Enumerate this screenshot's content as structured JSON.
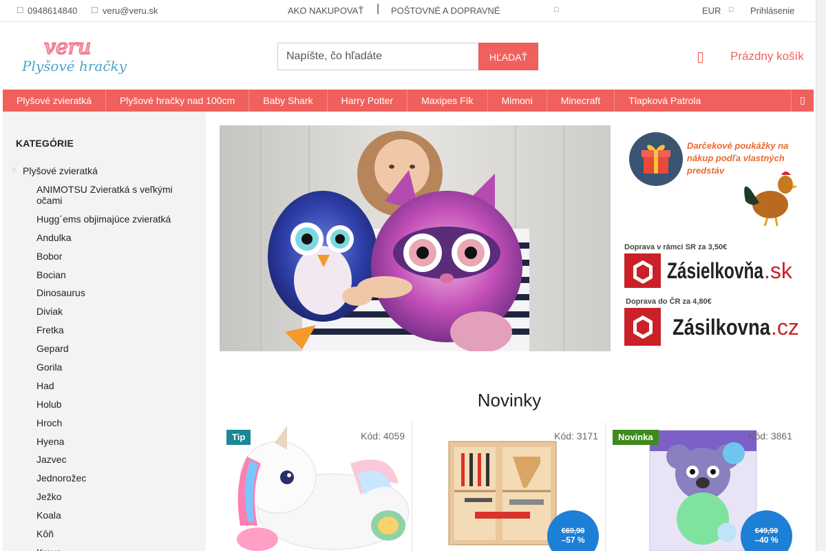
{
  "topbar": {
    "phone_icon": "phone-icon",
    "phone": "0948614840",
    "email_icon": "envelope-icon",
    "email": "veru@veru.sk",
    "link_shopping": "AKO NAKUPOVAŤ",
    "separator": "|",
    "link_shipping": "POŠTOVNÉ A DOPRAVNÉ",
    "more_icon": "chevron-down-icon",
    "currency": "EUR",
    "currency_icon": "chevron-down-icon",
    "login": "Prihlásenie"
  },
  "header": {
    "logo_word": "veru",
    "logo_sub": "Plyšové hračky",
    "search_placeholder": "Napíšte, čo hľadáte",
    "search_button": "HĽADAŤ",
    "cart_icon": "cart-icon",
    "cart_label": "Prázdny košík"
  },
  "nav": {
    "items": [
      "Plyšové zvieratká",
      "Plyšové hračky nad 100cm",
      "Baby Shark",
      "Harry Potter",
      "Maxipes Fík",
      "Mimoni",
      "Minecraft",
      "Tlapková Patrola"
    ],
    "more_icon": "menu-more-icon"
  },
  "sidebar": {
    "title": "KATEGÓRIE",
    "root": "Plyšové zvieratká",
    "items": [
      "ANIMOTSU Zvieratká s veľkými očami",
      "Hugg´ems objimajúce zvieratká",
      "Andulka",
      "Bobor",
      "Bocian",
      "Dinosaurus",
      "Diviak",
      "Fretka",
      "Gepard",
      "Gorila",
      "Had",
      "Holub",
      "Hroch",
      "Hyena",
      "Jazvec",
      "Jednorožec",
      "Ježko",
      "Koala",
      "Kôň",
      "Krava"
    ]
  },
  "promo": {
    "gift_text_1": "Darčekové poukážky na",
    "gift_text_2": "nákup podľa vlastných",
    "gift_text_3": "predstáv",
    "sk_note": "Doprava v rámci SR za 3,50€",
    "sk_brand": "Zásielkovňa",
    "sk_tld": ".sk",
    "cz_note": "Doprava do ČR za 4,80€",
    "cz_brand": "Zásilkovna",
    "cz_tld": ".cz"
  },
  "main": {
    "section_title": "Novinky",
    "products": [
      {
        "flag": "Tip",
        "code": "Kód: 4059"
      },
      {
        "flag": "",
        "code": "Kód: 3171",
        "old_price": "€69,90",
        "discount": "–57 %"
      },
      {
        "flag": "Novinka",
        "code": "Kód: 3861",
        "old_price": "€49,90",
        "discount": "–40 %"
      }
    ]
  },
  "colors": {
    "accent": "#f0615d",
    "tip": "#1a8896",
    "new": "#3d8b1c",
    "discount_badge": "#1d7fd6",
    "sidebar_bg": "#f3f3f3"
  }
}
